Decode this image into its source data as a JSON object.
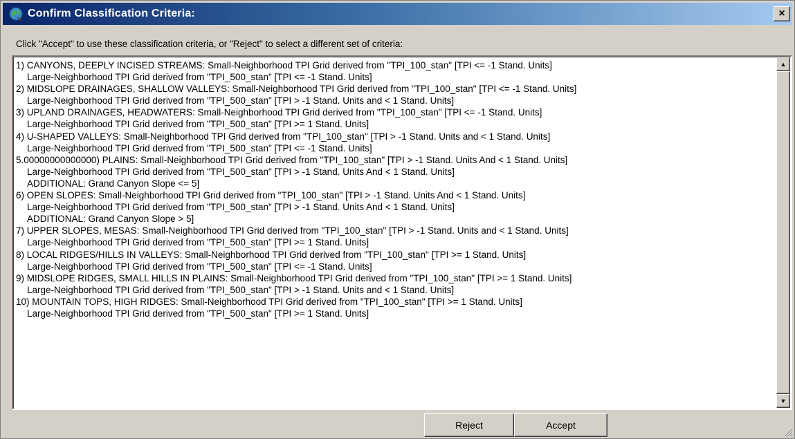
{
  "window": {
    "title": "Confirm Classification Criteria:",
    "close_label": "×"
  },
  "instruction": "Click \"Accept\" to use these classification criteria, or \"Reject\" to select a different set of criteria:",
  "criteria_lines": [
    {
      "text": "1) CANYONS, DEEPLY INCISED STREAMS: Small-Neighborhood TPI Grid derived from \"TPI_100_stan\"  [TPI  <= -1  Stand. Units]",
      "indent": false
    },
    {
      "text": "Large-Neighborhood TPI Grid derived from \"TPI_500_stan\" [TPI  <= -1  Stand. Units]",
      "indent": true
    },
    {
      "text": "2) MIDSLOPE DRAINAGES, SHALLOW VALLEYS: Small-Neighborhood TPI Grid derived from \"TPI_100_stan\"  [TPI  <= -1  Stand. Units]",
      "indent": false
    },
    {
      "text": "Large-Neighborhood TPI Grid derived from \"TPI_500_stan\" [TPI  > -1  Stand. Units and  < 1  Stand. Units]",
      "indent": true
    },
    {
      "text": "3) UPLAND DRAINAGES, HEADWATERS: Small-Neighborhood TPI Grid derived from \"TPI_100_stan\"  [TPI  <= -1  Stand. Units]",
      "indent": false
    },
    {
      "text": "Large-Neighborhood TPI Grid derived from \"TPI_500_stan\" [TPI  >= 1  Stand. Units]",
      "indent": true
    },
    {
      "text": "4) U-SHAPED VALLEYS: Small-Neighborhood TPI Grid derived from \"TPI_100_stan\"  [TPI  > -1  Stand. Units and  < 1  Stand. Units]",
      "indent": false
    },
    {
      "text": "Large-Neighborhood TPI Grid derived from \"TPI_500_stan\" [TPI  <= -1  Stand. Units]",
      "indent": true
    },
    {
      "text": "5.00000000000000) PLAINS: Small-Neighborhood TPI Grid derived from \"TPI_100_stan\"  [TPI  > -1  Stand. Units And  < 1  Stand. Units]",
      "indent": false
    },
    {
      "text": "Large-Neighborhood TPI Grid derived from \"TPI_500_stan\" [TPI  > -1  Stand. Units And  < 1  Stand. Units]",
      "indent": true
    },
    {
      "text": "ADDITIONAL: Grand Canyon Slope  <= 5]",
      "indent": true
    },
    {
      "text": "6) OPEN SLOPES: Small-Neighborhood TPI Grid derived from \"TPI_100_stan\"  [TPI  > -1  Stand. Units And  < 1  Stand. Units]",
      "indent": false
    },
    {
      "text": "Large-Neighborhood TPI Grid derived from \"TPI_500_stan\" [TPI  > -1  Stand. Units And  < 1  Stand. Units]",
      "indent": true
    },
    {
      "text": "ADDITIONAL: Grand Canyon Slope  > 5]",
      "indent": true
    },
    {
      "text": "7) UPPER SLOPES, MESAS: Small-Neighborhood TPI Grid derived from \"TPI_100_stan\"  [TPI  > -1  Stand. Units and  < 1  Stand. Units]",
      "indent": false
    },
    {
      "text": "Large-Neighborhood TPI Grid derived from \"TPI_500_stan\" [TPI  >= 1  Stand. Units]",
      "indent": true
    },
    {
      "text": "8) LOCAL RIDGES/HILLS IN VALLEYS: Small-Neighborhood TPI Grid derived from \"TPI_100_stan\"  [TPI  >= 1  Stand. Units]",
      "indent": false
    },
    {
      "text": "Large-Neighborhood TPI Grid derived from \"TPI_500_stan\" [TPI  <= -1  Stand. Units]",
      "indent": true
    },
    {
      "text": "9) MIDSLOPE RIDGES, SMALL HILLS IN PLAINS: Small-Neighborhood TPI Grid derived from \"TPI_100_stan\"  [TPI  >= 1  Stand. Units]",
      "indent": false
    },
    {
      "text": "Large-Neighborhood TPI Grid derived from \"TPI_500_stan\" [TPI  > -1  Stand. Units and  < 1  Stand. Units]",
      "indent": true
    },
    {
      "text": "10) MOUNTAIN TOPS, HIGH RIDGES: Small-Neighborhood TPI Grid derived from \"TPI_100_stan\"  [TPI  >= 1  Stand. Units]",
      "indent": false
    },
    {
      "text": "Large-Neighborhood TPI Grid derived from \"TPI_500_stan\" [TPI  >= 1  Stand. Units]",
      "indent": true
    }
  ],
  "buttons": {
    "reject": "Reject",
    "accept": "Accept"
  },
  "scrollbar": {
    "up_arrow": "▲",
    "down_arrow": "▼"
  },
  "icons": {
    "app": "globe-icon",
    "close": "close-icon",
    "resize": "resize-grip-icon"
  }
}
